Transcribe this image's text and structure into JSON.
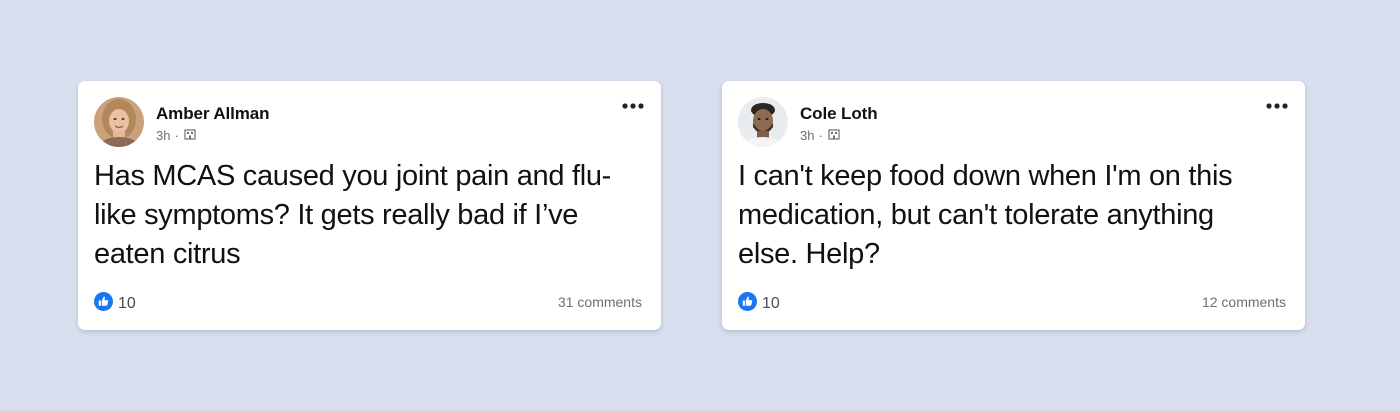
{
  "posts": [
    {
      "author": "Amber Allman",
      "time": "3h",
      "separator": "·",
      "privacy_icon": "group-building-icon",
      "text": "Has MCAS caused you joint pain and flu-like symptoms? It gets really bad if I’ve eaten citrus",
      "likes": "10",
      "comments": "31 comments"
    },
    {
      "author": "Cole Loth",
      "time": "3h",
      "separator": "·",
      "privacy_icon": "group-building-icon",
      "text": "I can't keep food down when I'm on this medication, but can't tolerate anything else. Help?",
      "likes": "10",
      "comments": "12 comments"
    }
  ],
  "colors": {
    "background": "#d7deee",
    "card": "#ffffff",
    "like_blue": "#1877f2",
    "meta_gray": "#6b6f76"
  }
}
